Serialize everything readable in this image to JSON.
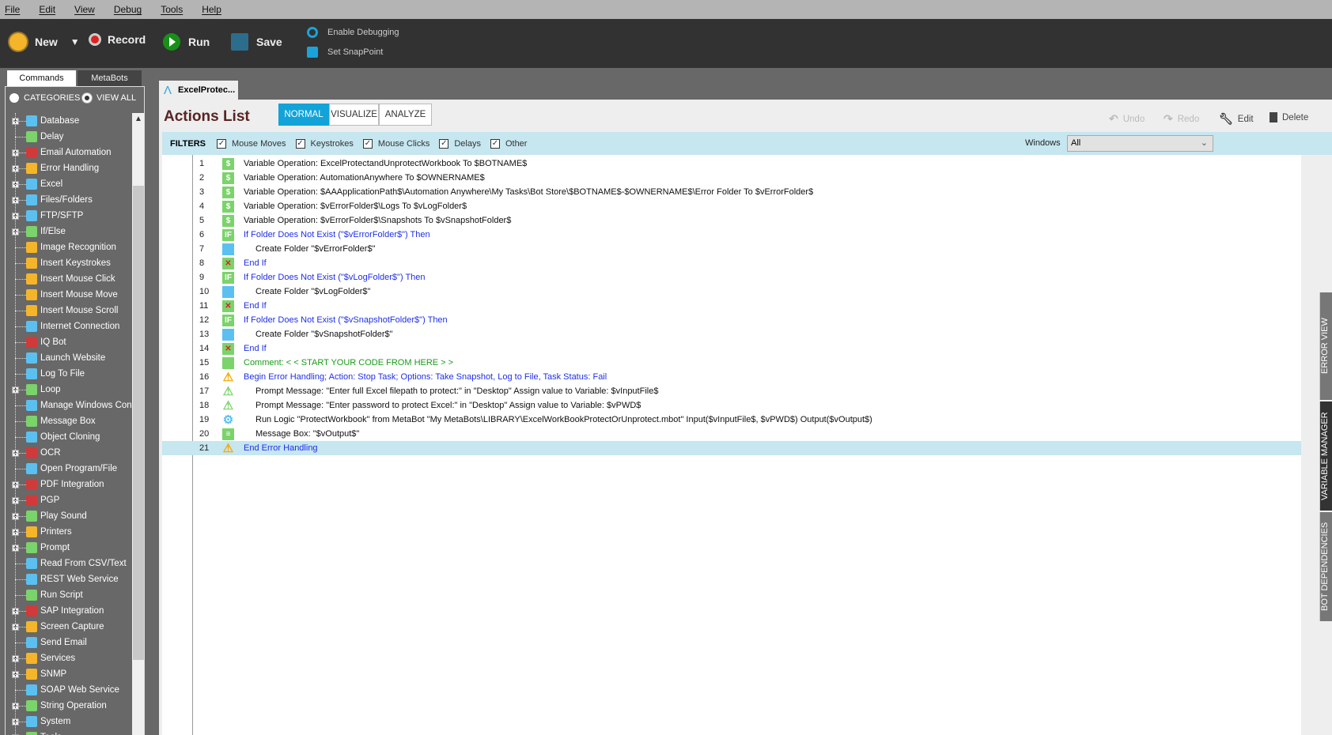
{
  "menu": [
    "File",
    "Edit",
    "View",
    "Debug",
    "Tools",
    "Help"
  ],
  "toolbar": {
    "new": "New",
    "record": "Record",
    "run": "Run",
    "save": "Save",
    "enable_debugging": "Enable Debugging",
    "set_snappoint": "Set SnapPoint"
  },
  "left_tabs": {
    "commands": "Commands",
    "metabots": "MetaBots"
  },
  "radios": {
    "categories": "CATEGORIES",
    "view_all": "VIEW ALL"
  },
  "commands": [
    {
      "label": "Database",
      "exp": true,
      "color": "#5bc0f0"
    },
    {
      "label": "Delay",
      "exp": false,
      "color": "#7bd36b"
    },
    {
      "label": "Email Automation",
      "exp": true,
      "color": "#d03a3a"
    },
    {
      "label": "Error Handling",
      "exp": true,
      "color": "#f5b52a"
    },
    {
      "label": "Excel",
      "exp": true,
      "color": "#5bc0f0"
    },
    {
      "label": "Files/Folders",
      "exp": true,
      "color": "#5bc0f0"
    },
    {
      "label": "FTP/SFTP",
      "exp": true,
      "color": "#5bc0f0"
    },
    {
      "label": "If/Else",
      "exp": true,
      "color": "#7bd36b"
    },
    {
      "label": "Image Recognition",
      "exp": false,
      "color": "#f5b52a"
    },
    {
      "label": "Insert Keystrokes",
      "exp": false,
      "color": "#f5b52a"
    },
    {
      "label": "Insert Mouse Click",
      "exp": false,
      "color": "#f5b52a"
    },
    {
      "label": "Insert Mouse Move",
      "exp": false,
      "color": "#f5b52a"
    },
    {
      "label": "Insert Mouse Scroll",
      "exp": false,
      "color": "#f5b52a"
    },
    {
      "label": "Internet Connection",
      "exp": false,
      "color": "#5bc0f0"
    },
    {
      "label": "IQ Bot",
      "exp": false,
      "color": "#d03a3a"
    },
    {
      "label": "Launch Website",
      "exp": false,
      "color": "#5bc0f0"
    },
    {
      "label": "Log To File",
      "exp": false,
      "color": "#5bc0f0"
    },
    {
      "label": "Loop",
      "exp": true,
      "color": "#7bd36b"
    },
    {
      "label": "Manage Windows Controls",
      "exp": false,
      "color": "#5bc0f0"
    },
    {
      "label": "Message Box",
      "exp": false,
      "color": "#7bd36b"
    },
    {
      "label": "Object Cloning",
      "exp": false,
      "color": "#5bc0f0"
    },
    {
      "label": "OCR",
      "exp": true,
      "color": "#d03a3a"
    },
    {
      "label": "Open Program/File",
      "exp": false,
      "color": "#5bc0f0"
    },
    {
      "label": "PDF Integration",
      "exp": true,
      "color": "#d03a3a"
    },
    {
      "label": "PGP",
      "exp": true,
      "color": "#d03a3a"
    },
    {
      "label": "Play Sound",
      "exp": true,
      "color": "#7bd36b"
    },
    {
      "label": "Printers",
      "exp": true,
      "color": "#f5b52a"
    },
    {
      "label": "Prompt",
      "exp": true,
      "color": "#7bd36b"
    },
    {
      "label": "Read From CSV/Text",
      "exp": false,
      "color": "#5bc0f0"
    },
    {
      "label": "REST Web Service",
      "exp": false,
      "color": "#5bc0f0"
    },
    {
      "label": "Run Script",
      "exp": false,
      "color": "#7bd36b"
    },
    {
      "label": "SAP Integration",
      "exp": true,
      "color": "#d03a3a"
    },
    {
      "label": "Screen Capture",
      "exp": true,
      "color": "#f5b52a"
    },
    {
      "label": "Send Email",
      "exp": false,
      "color": "#5bc0f0"
    },
    {
      "label": "Services",
      "exp": true,
      "color": "#f5b52a"
    },
    {
      "label": "SNMP",
      "exp": true,
      "color": "#f5b52a"
    },
    {
      "label": "SOAP Web Service",
      "exp": false,
      "color": "#5bc0f0"
    },
    {
      "label": "String Operation",
      "exp": true,
      "color": "#7bd36b"
    },
    {
      "label": "System",
      "exp": true,
      "color": "#5bc0f0"
    },
    {
      "label": "Tools",
      "exp": true,
      "color": "#7bd36b"
    }
  ],
  "doc_tab": "ExcelProtec...",
  "actions": {
    "title": "Actions List",
    "modes": [
      "NORMAL",
      "VISUALIZE",
      "ANALYZE"
    ],
    "active_mode": "NORMAL",
    "undo": "Undo",
    "redo": "Redo",
    "edit": "Edit",
    "delete": "Delete"
  },
  "filters": {
    "label": "FILTERS",
    "items": [
      {
        "label": "Mouse Moves",
        "checked": true
      },
      {
        "label": "Keystrokes",
        "checked": true
      },
      {
        "label": "Mouse Clicks",
        "checked": true
      },
      {
        "label": "Delays",
        "checked": true
      },
      {
        "label": "Other",
        "checked": true
      }
    ],
    "windows_label": "Windows",
    "windows_value": "All"
  },
  "rows": [
    {
      "n": "1",
      "icon": "variable",
      "text": "Variable Operation: ExcelProtectandUnprotectWorkbook To $BOTNAME$",
      "style": "",
      "indent": false
    },
    {
      "n": "2",
      "icon": "variable",
      "text": "Variable Operation: AutomationAnywhere To $OWNERNAME$",
      "style": "",
      "indent": false
    },
    {
      "n": "3",
      "icon": "variable",
      "text": "Variable Operation: $AAApplicationPath$\\Automation Anywhere\\My Tasks\\Bot Store\\$BOTNAME$-$OWNERNAME$\\Error Folder To $vErrorFolder$",
      "style": "",
      "indent": false
    },
    {
      "n": "4",
      "icon": "variable",
      "text": "Variable Operation: $vErrorFolder$\\Logs To $vLogFolder$",
      "style": "",
      "indent": false
    },
    {
      "n": "5",
      "icon": "variable",
      "text": "Variable Operation: $vErrorFolder$\\Snapshots To $vSnapshotFolder$",
      "style": "",
      "indent": false
    },
    {
      "n": "6",
      "icon": "if",
      "text": "If Folder Does Not Exist (\"$vErrorFolder$\")  Then",
      "style": "blue",
      "indent": false
    },
    {
      "n": "7",
      "icon": "folder",
      "text": "Create Folder \"$vErrorFolder$\"",
      "style": "",
      "indent": true
    },
    {
      "n": "8",
      "icon": "endif",
      "text": "End If",
      "style": "blue",
      "indent": false
    },
    {
      "n": "9",
      "icon": "if",
      "text": "If Folder Does Not Exist (\"$vLogFolder$\")  Then",
      "style": "blue",
      "indent": false
    },
    {
      "n": "10",
      "icon": "folder",
      "text": "Create Folder \"$vLogFolder$\"",
      "style": "",
      "indent": true
    },
    {
      "n": "11",
      "icon": "endif",
      "text": "End If",
      "style": "blue",
      "indent": false
    },
    {
      "n": "12",
      "icon": "if",
      "text": "If Folder Does Not Exist (\"$vSnapshotFolder$\")  Then",
      "style": "blue",
      "indent": false
    },
    {
      "n": "13",
      "icon": "folder",
      "text": "Create Folder \"$vSnapshotFolder$\"",
      "style": "",
      "indent": true
    },
    {
      "n": "14",
      "icon": "endif",
      "text": "End If",
      "style": "blue",
      "indent": false
    },
    {
      "n": "15",
      "icon": "comment",
      "text": "Comment: < < START YOUR CODE FROM HERE > >",
      "style": "green",
      "indent": false
    },
    {
      "n": "16",
      "icon": "error",
      "text": "Begin Error Handling; Action: Stop Task; Options: Take Snapshot, Log to File,  Task Status: Fail",
      "style": "blue",
      "indent": false
    },
    {
      "n": "17",
      "icon": "prompt",
      "text": "Prompt Message: \"Enter full Excel filepath to protect:\" in \"Desktop\" Assign value to Variable: $vInputFile$",
      "style": "",
      "indent": true
    },
    {
      "n": "18",
      "icon": "prompt",
      "text": "Prompt Message: \"Enter password to protect Excel:\" in \"Desktop\" Assign value to Variable: $vPWD$",
      "style": "",
      "indent": true
    },
    {
      "n": "19",
      "icon": "metabot",
      "text": "Run Logic \"ProtectWorkbook\" from MetaBot \"My MetaBots\\LIBRARY\\ExcelWorkBookProtectOrUnprotect.mbot\" Input($vInputFile$, $vPWD$) Output($vOutput$)",
      "style": "",
      "indent": true
    },
    {
      "n": "20",
      "icon": "messagebox",
      "text": "Message Box: \"$vOutput$\"",
      "style": "",
      "indent": true
    },
    {
      "n": "21",
      "icon": "error",
      "text": "End Error Handling",
      "style": "blue",
      "indent": false,
      "selected": true
    }
  ],
  "side_tabs": [
    "ERROR VIEW",
    "VARIABLE MANAGER",
    "BOT DEPENDENCIES"
  ],
  "active_side_tab": "VARIABLE MANAGER"
}
